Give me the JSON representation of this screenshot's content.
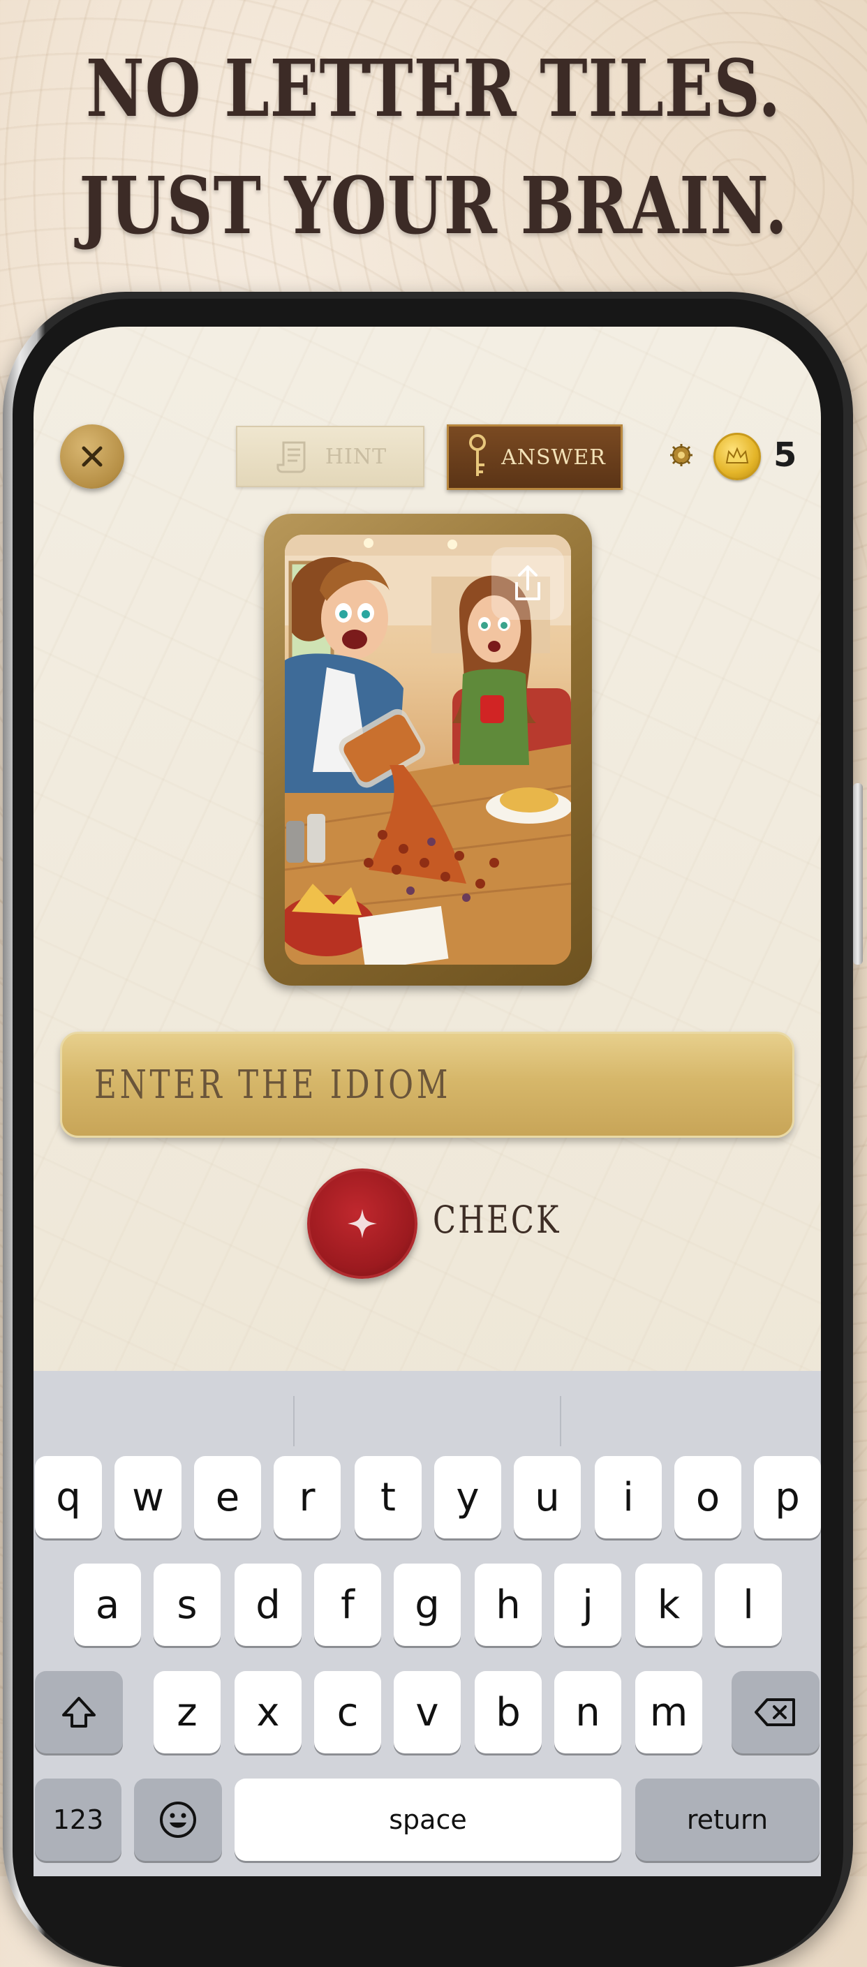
{
  "headline": {
    "line1": "NO LETTER TILES.",
    "line2": "JUST YOUR BRAIN."
  },
  "toolbar": {
    "hint_label": "HINT",
    "answer_label": "ANSWER",
    "coin_count": "5"
  },
  "input": {
    "placeholder": "ENTER THE IDIOM"
  },
  "check": {
    "label": "CHECK"
  },
  "keyboard": {
    "row1": [
      "q",
      "w",
      "e",
      "r",
      "t",
      "y",
      "u",
      "i",
      "o",
      "p"
    ],
    "row2": [
      "a",
      "s",
      "d",
      "f",
      "g",
      "h",
      "j",
      "k",
      "l"
    ],
    "row3": [
      "z",
      "x",
      "c",
      "v",
      "b",
      "n",
      "m"
    ],
    "numbers_label": "123",
    "space_label": "space",
    "return_label": "return"
  },
  "colors": {
    "gold": "#d6b76a",
    "check_red": "#9c1a1f",
    "answer_brown": "#5b3416"
  },
  "icons": [
    "close-icon",
    "scroll-icon",
    "key-icon",
    "gear-icon",
    "crown-coin-icon",
    "share-icon",
    "sparkle-icon",
    "shift-icon",
    "backspace-icon",
    "emoji-icon"
  ]
}
